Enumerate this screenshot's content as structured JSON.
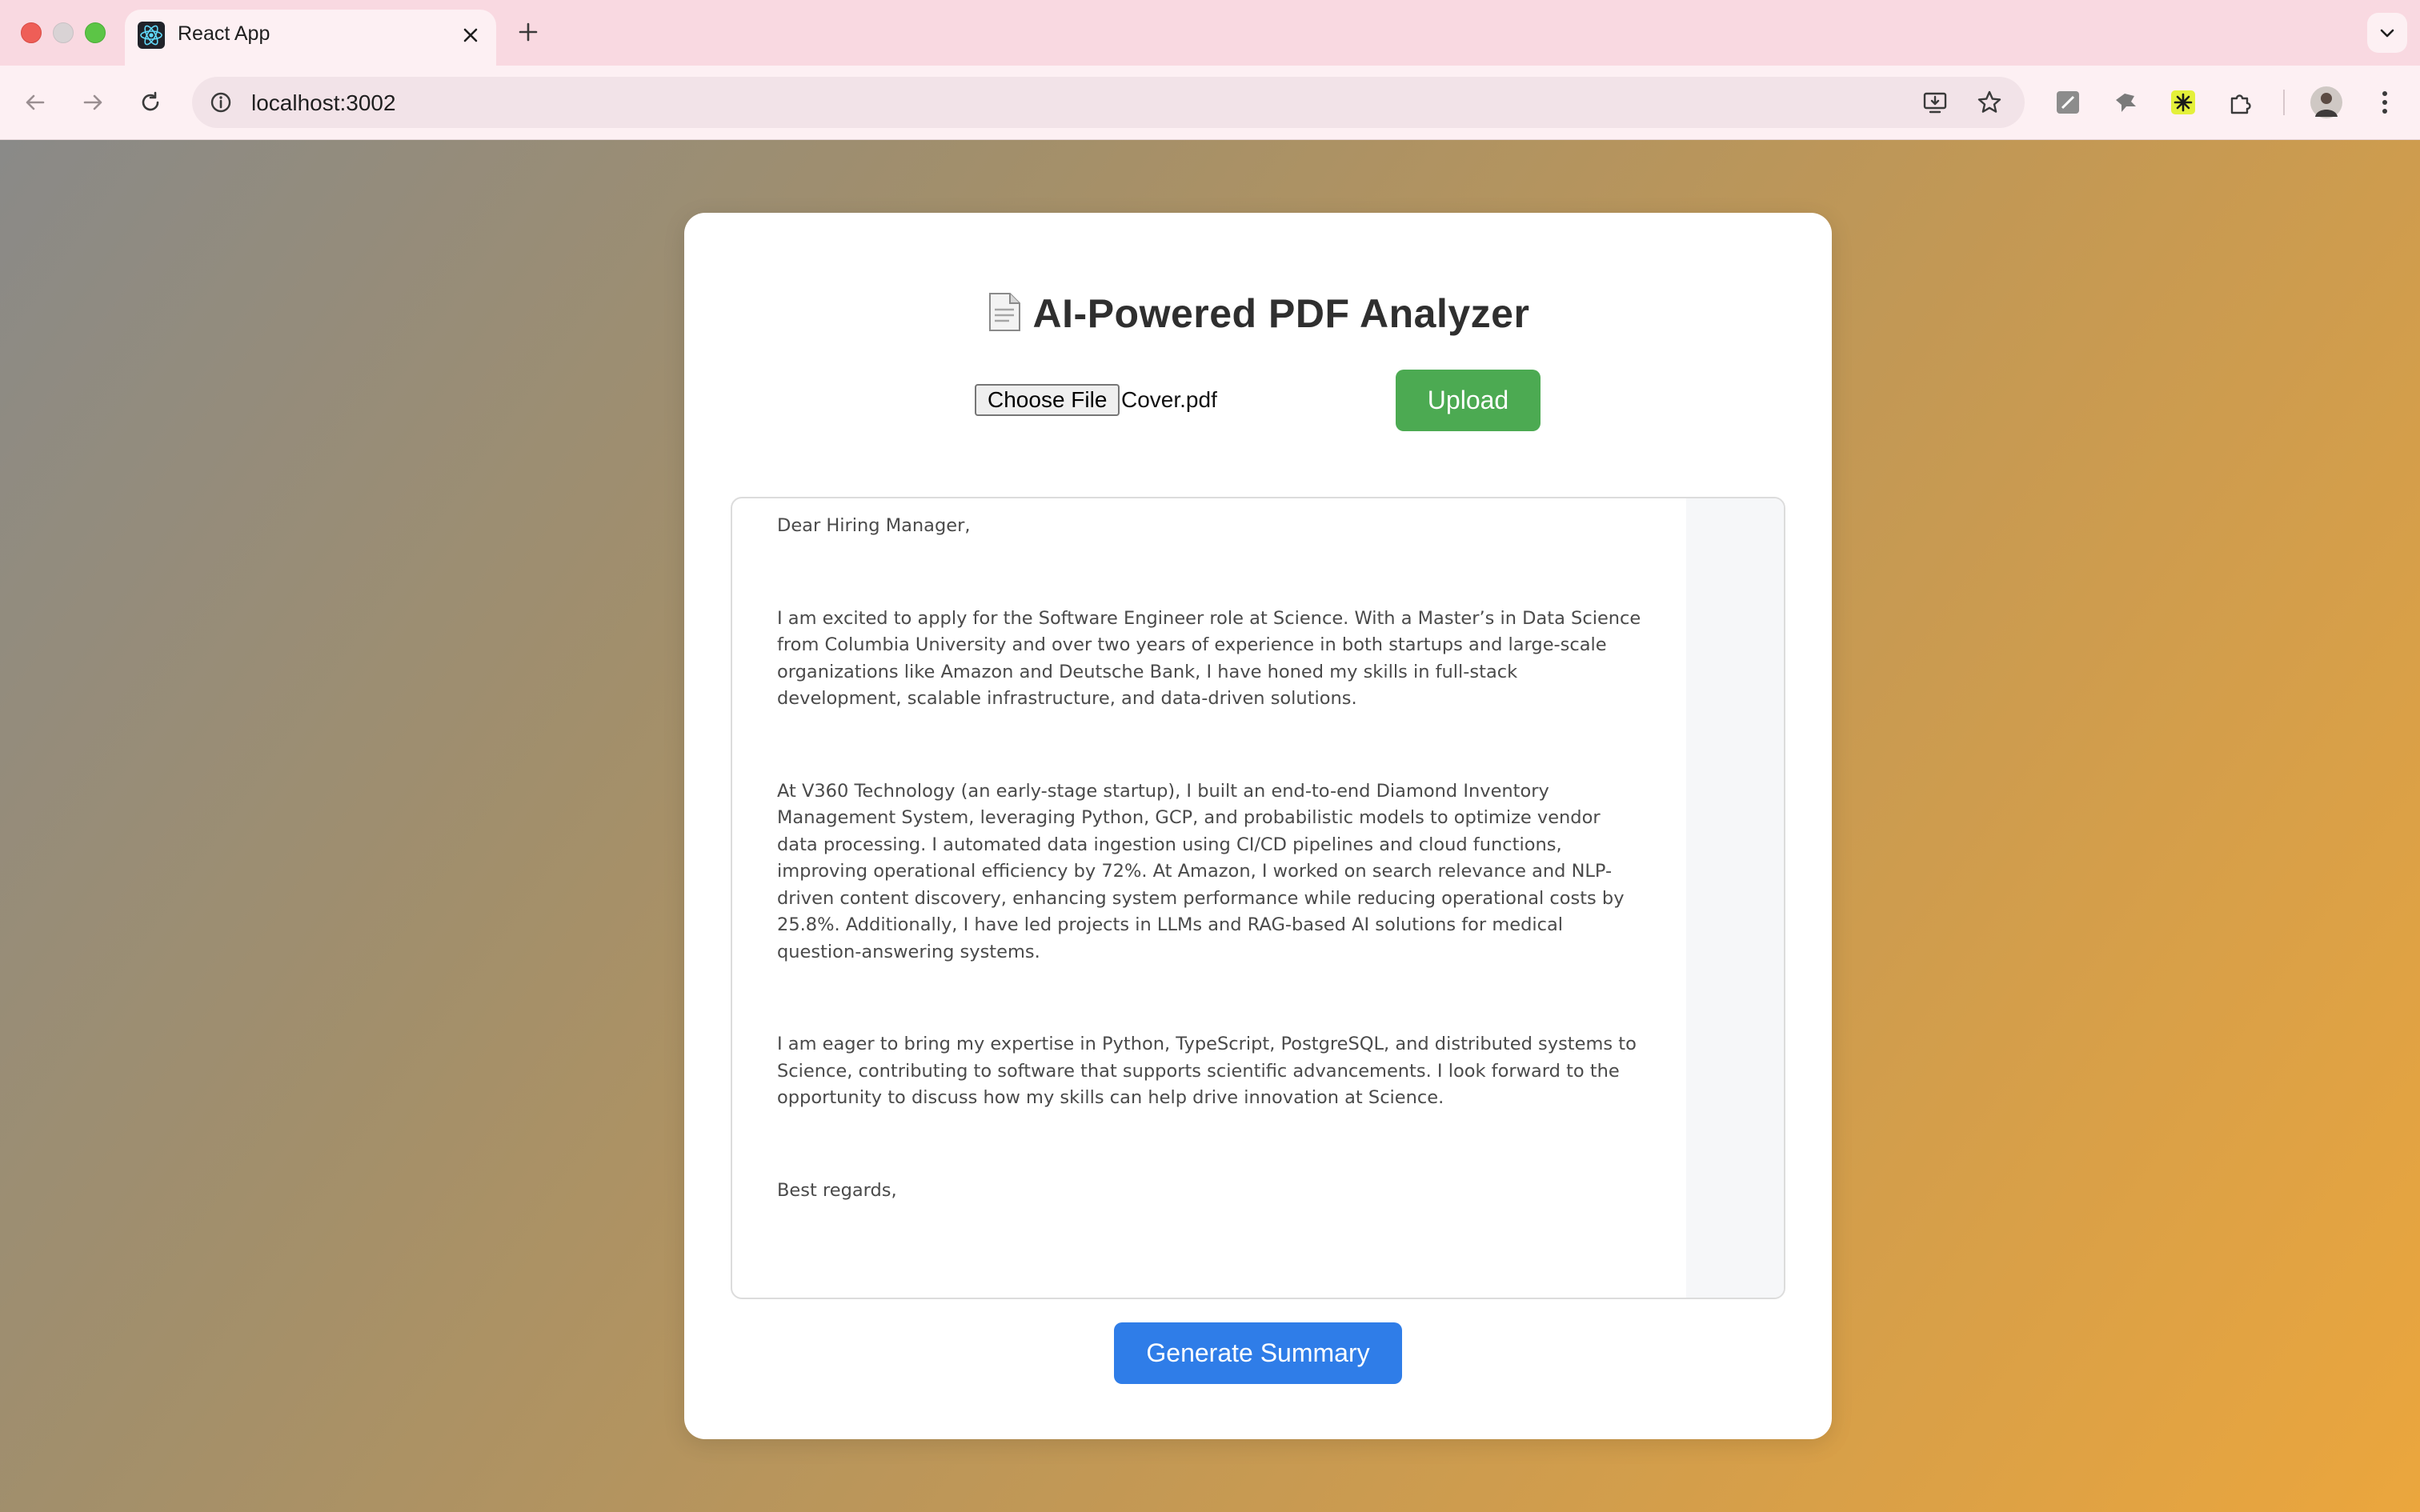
{
  "browser": {
    "tab": {
      "title": "React App"
    },
    "url": "localhost:3002"
  },
  "app": {
    "title": "AI-Powered PDF Analyzer",
    "file_input": {
      "button_label": "Choose File",
      "file_name": "Cover.pdf"
    },
    "upload_label": "Upload",
    "document_text": [
      "Dear Hiring Manager,",
      "I am excited to apply for the Software Engineer role at Science. With a Master’s in Data Science from Columbia University and over two years of experience in both startups and large-scale organizations like Amazon and Deutsche Bank, I have honed my skills in full-stack development, scalable infrastructure, and data-driven solutions.",
      "At V360 Technology (an early-stage startup), I built an end-to-end Diamond Inventory Management System, leveraging Python, GCP, and probabilistic models to optimize vendor data processing. I automated data ingestion using CI/CD pipelines and cloud functions, improving operational efficiency by 72%. At Amazon, I worked on search relevance and NLP-driven content discovery, enhancing system performance while reducing operational costs by 25.8%. Additionally, I have led projects in LLMs and RAG-based AI solutions for medical question-answering systems.",
      "I am eager to bring my expertise in Python, TypeScript, PostgreSQL, and distributed systems to Science, contributing to software that supports scientific advancements. I look forward to the opportunity to discuss how my skills can help drive innovation at Science.",
      "Best regards,"
    ],
    "summary_label": "Generate Summary"
  },
  "colors": {
    "upload_button": "#4caa52",
    "summary_button": "#2f7de8",
    "tabbar": "#f9d9e1"
  }
}
